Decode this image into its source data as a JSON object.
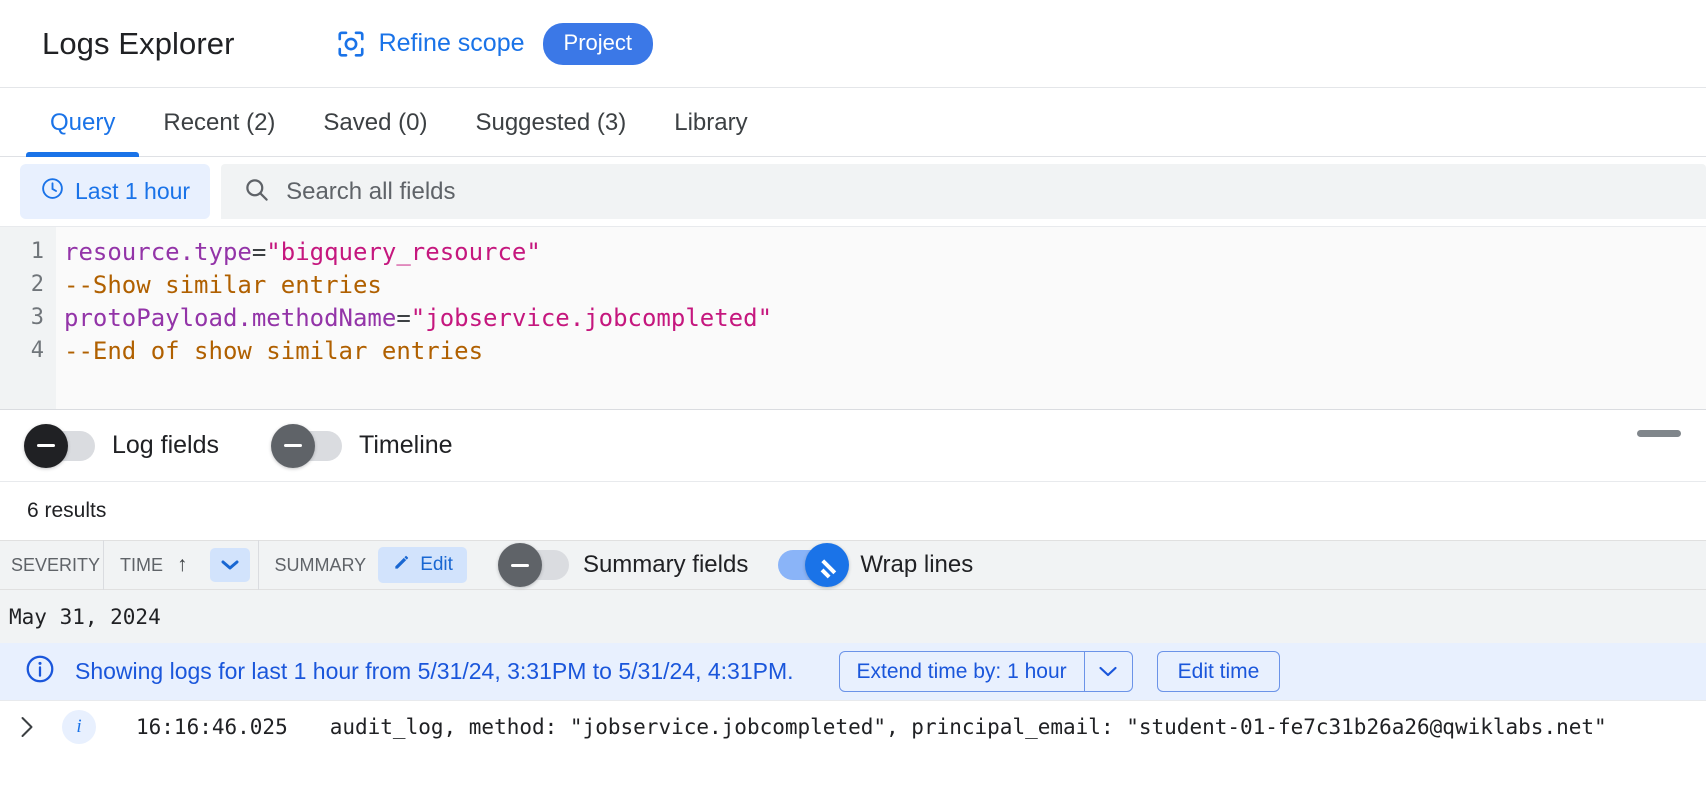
{
  "header": {
    "title": "Logs Explorer",
    "refine_scope_label": "Refine scope",
    "scope_chip": "Project",
    "scope_icon": "crop-focus-icon"
  },
  "tabs": [
    {
      "label": "Query",
      "active": true
    },
    {
      "label": "Recent (2)",
      "active": false
    },
    {
      "label": "Saved (0)",
      "active": false
    },
    {
      "label": "Suggested (3)",
      "active": false
    },
    {
      "label": "Library",
      "active": false
    }
  ],
  "query_bar": {
    "time_range_label": "Last 1 hour",
    "clock_icon": "clock-icon",
    "search_icon": "search-icon",
    "search_placeholder": "Search all fields",
    "search_value": ""
  },
  "editor": {
    "lines": [
      {
        "number": "1",
        "tokens": [
          {
            "text": "resource.type",
            "type": "ident"
          },
          {
            "text": "=",
            "type": "op"
          },
          {
            "text": "\"bigquery_resource\"",
            "type": "str"
          }
        ]
      },
      {
        "number": "2",
        "tokens": [
          {
            "text": "--Show similar entries",
            "type": "comment"
          }
        ]
      },
      {
        "number": "3",
        "tokens": [
          {
            "text": "protoPayload.methodName",
            "type": "ident"
          },
          {
            "text": "=",
            "type": "op"
          },
          {
            "text": "\"jobservice.jobcompleted\"",
            "type": "str"
          }
        ]
      },
      {
        "number": "4",
        "tokens": [
          {
            "text": "--End of show similar entries",
            "type": "comment"
          }
        ]
      }
    ]
  },
  "view_toggles": [
    {
      "label": "Log fields",
      "on": false,
      "style": "dark"
    },
    {
      "label": "Timeline",
      "on": false,
      "style": "grey"
    }
  ],
  "results": {
    "count_label": "6 results"
  },
  "table_header": {
    "severity": "SEVERITY",
    "time": "TIME",
    "sort_arrow": "↑",
    "dropdown_icon": "chevron-down-icon",
    "summary": "SUMMARY",
    "edit_label": "Edit",
    "edit_icon": "pencil-icon",
    "toggles": [
      {
        "label": "Summary fields",
        "on": false,
        "style": "grey"
      },
      {
        "label": "Wrap lines",
        "on": true,
        "style": "on"
      }
    ]
  },
  "date_group": {
    "label": "May 31, 2024"
  },
  "info_banner": {
    "icon": "info-circle-icon",
    "message": "Showing logs for last 1 hour from 5/31/24, 3:31PM to 5/31/24, 4:31PM.",
    "extend_label": "Extend time by: 1 hour",
    "extend_arrow_icon": "chevron-down-icon",
    "edit_time_label": "Edit time"
  },
  "log_entries": [
    {
      "expand_icon": "chevron-right-icon",
      "severity_icon": "info-icon",
      "time": "16:16:46.025",
      "summary": "audit_log, method: \"jobservice.jobcompleted\", principal_email: \"student-01-fe7c31b26a26@qwiklabs.net\""
    }
  ],
  "colors": {
    "accent_blue": "#1a73e8",
    "chip_blue": "#3b78e7",
    "light_blue_bg": "#e8f0fe",
    "ident_purple": "#9334a8",
    "string_pink": "#c5177e",
    "comment_brown": "#b06000"
  }
}
